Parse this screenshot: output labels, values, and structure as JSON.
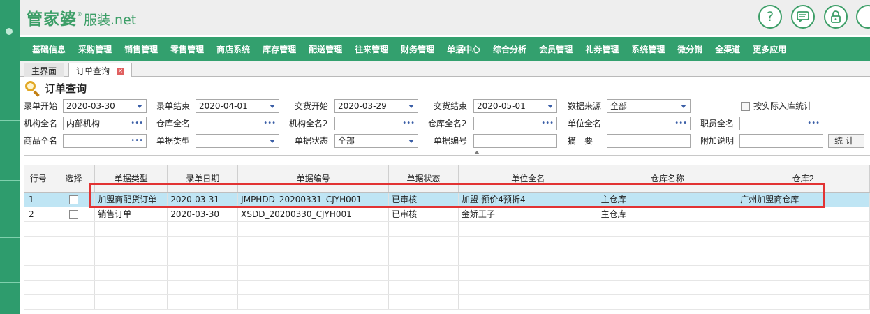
{
  "brand": {
    "logo_main": "管家婆",
    "logo_reg": "®",
    "logo_sub": "服装.net"
  },
  "header_buttons": [
    {
      "icon": "help-icon",
      "glyph": "?"
    },
    {
      "icon": "message-icon",
      "glyph": "💬"
    },
    {
      "icon": "lock-icon",
      "glyph": "🔒"
    }
  ],
  "nav": [
    "基础信息",
    "采购管理",
    "销售管理",
    "零售管理",
    "商店系统",
    "库存管理",
    "配送管理",
    "往来管理",
    "财务管理",
    "单据中心",
    "综合分析",
    "会员管理",
    "礼券管理",
    "系统管理",
    "微分销",
    "全渠道",
    "更多应用"
  ],
  "tabs": [
    {
      "label": "主界面"
    },
    {
      "label": "订单查询"
    }
  ],
  "page": {
    "title": "订单查询"
  },
  "form": {
    "entry_start_label": "录单开始",
    "entry_start_value": "2020-03-30",
    "entry_end_label": "录单结束",
    "entry_end_value": "2020-04-01",
    "delivery_start_label": "交货开始",
    "delivery_start_value": "2020-03-29",
    "delivery_end_label": "交货结束",
    "delivery_end_value": "2020-05-01",
    "source_label": "数据来源",
    "source_value": "全部",
    "actual_stock_label": "按实际入库统计",
    "org_label": "机构全名",
    "org_value": "内部机构",
    "warehouse_label": "仓库全名",
    "warehouse_value": "",
    "org2_label": "机构全名2",
    "org2_value": "",
    "warehouse2_label": "仓库全名2",
    "warehouse2_value": "",
    "unit_label": "单位全名",
    "unit_value": "",
    "staff_label": "职员全名",
    "staff_value": "",
    "product_label": "商品全名",
    "product_value": "",
    "doctype_label": "单据类型",
    "doctype_value": "",
    "docstatus_label": "单据状态",
    "docstatus_value": "全部",
    "docno_label": "单据编号",
    "docno_value": "",
    "summary_label": "摘　要",
    "summary_value": "",
    "note_label": "附加说明",
    "note_value": "",
    "stat_button": "统计"
  },
  "table": {
    "columns": [
      "行号",
      "选择",
      "单据类型",
      "录单日期",
      "单据编号",
      "单据状态",
      "单位全名",
      "仓库名称",
      "仓库2"
    ],
    "rows": [
      {
        "idx": "1",
        "type": "加盟商配货订单",
        "date": "2020-03-31",
        "no": "JMPHDD_20200331_CJYH001",
        "status": "已审核",
        "unit": "加盟-预价4预折4",
        "wh": "主仓库",
        "wh2": "广州加盟商仓库"
      },
      {
        "idx": "2",
        "type": "销售订单",
        "date": "2020-03-30",
        "no": "XSDD_20200330_CJYH001",
        "status": "已审核",
        "unit": "金娇王子",
        "wh": "主仓库",
        "wh2": ""
      }
    ]
  },
  "colors": {
    "brand_green": "#3c9e67",
    "nav_green": "#33a06e",
    "selected_row": "#bfe5f4",
    "highlight_red": "#e23333"
  }
}
